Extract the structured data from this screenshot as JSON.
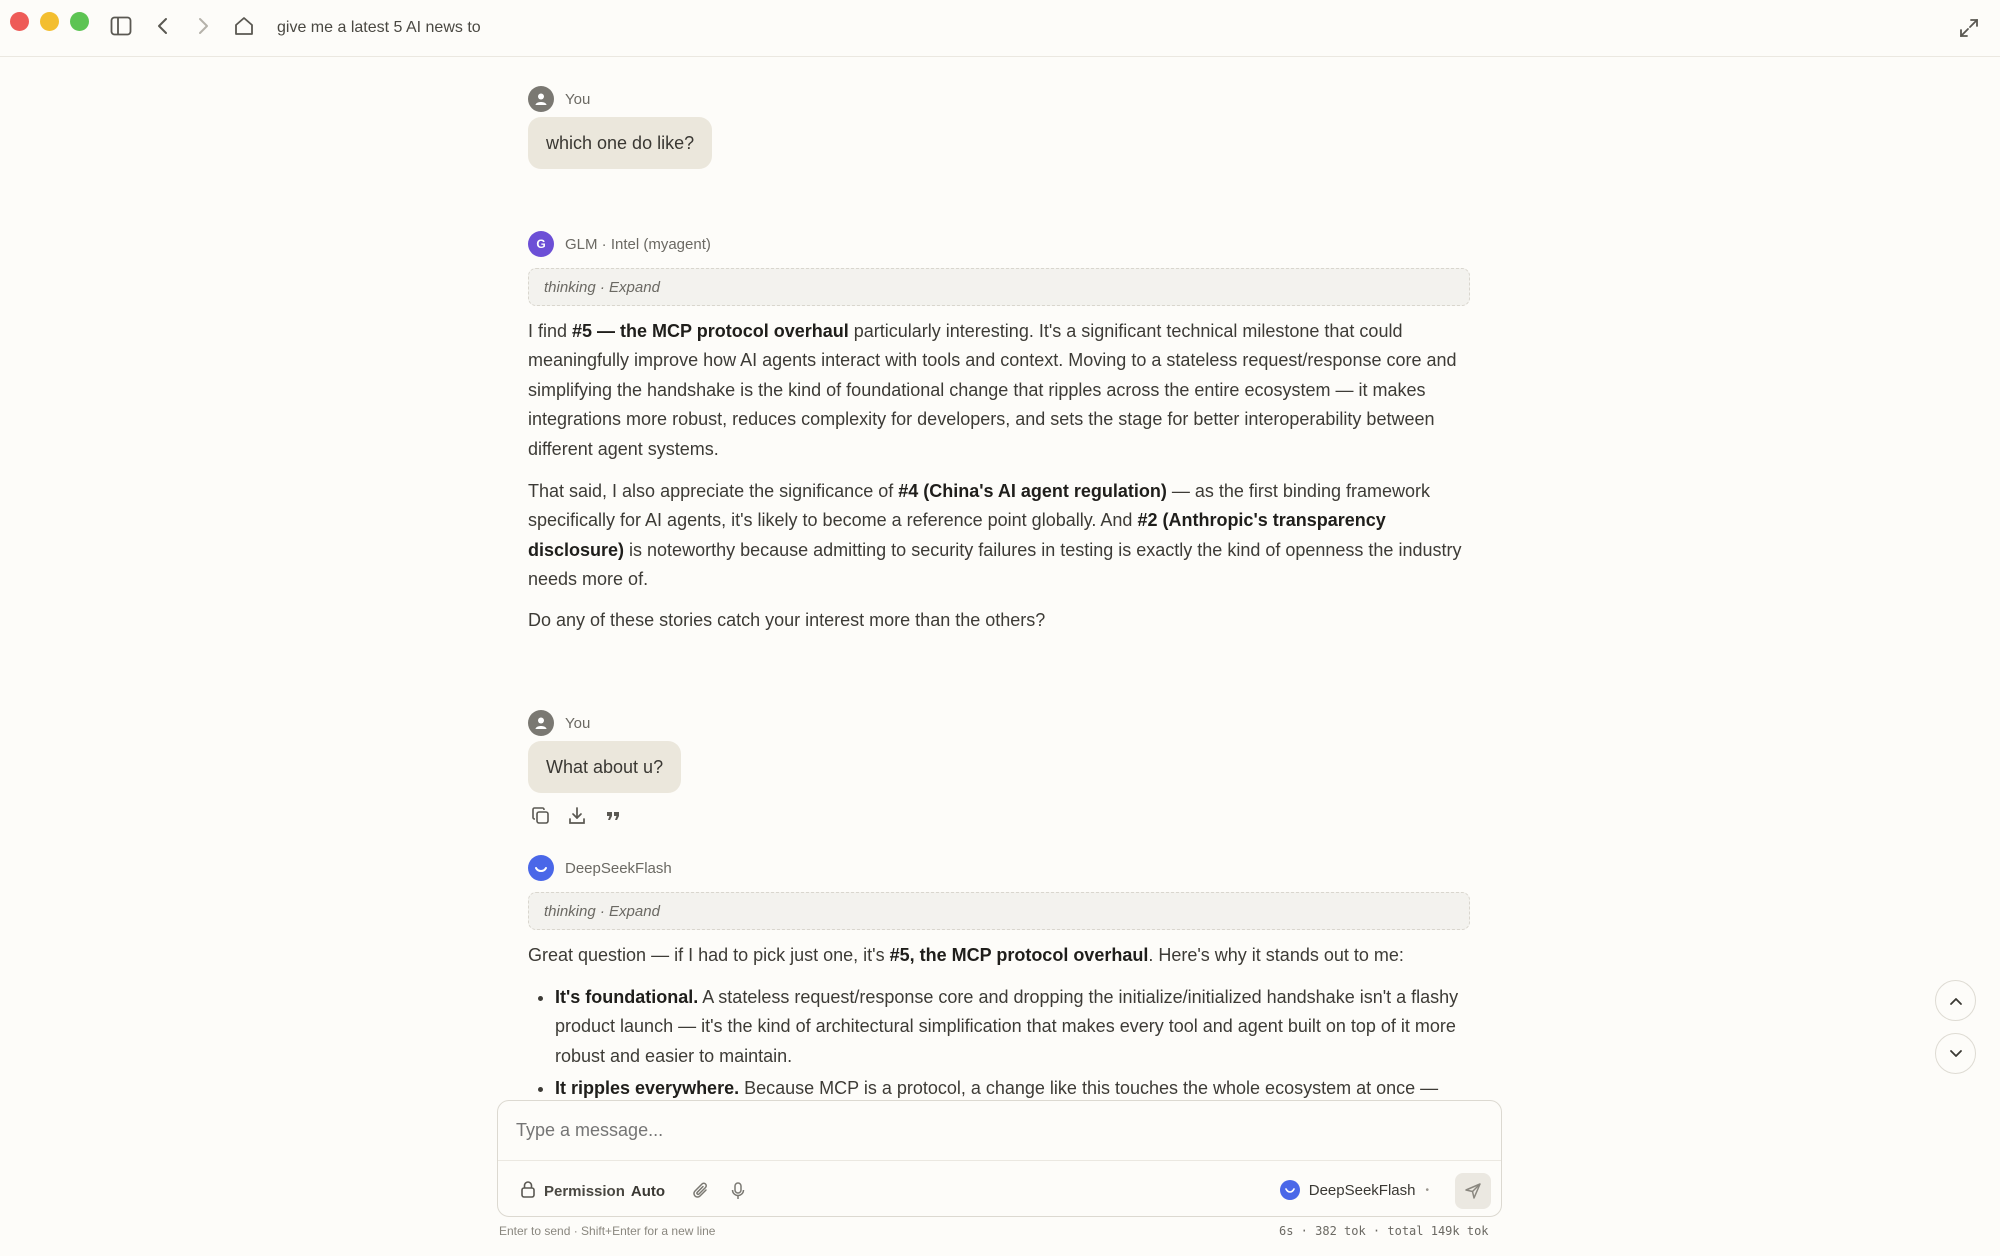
{
  "window": {
    "title": "give me a latest 5 AI news to"
  },
  "messages": [
    {
      "author": "You",
      "text": "which one do like?"
    },
    {
      "author": "GLM · Intel  (myagent)",
      "avatar_letter": "G",
      "thinking": "thinking · Expand",
      "paragraphs": [
        [
          {
            "t": "I find "
          },
          {
            "t": "#5 — the MCP protocol overhaul",
            "b": true
          },
          {
            "t": " particularly interesting. It's a significant technical milestone that could meaningfully improve how AI agents interact with tools and context. Moving to a stateless request/response core and simplifying the handshake is the kind of foundational change that ripples across the entire ecosystem — it makes integrations more robust, reduces complexity for developers, and sets the stage for better interoperability between different agent systems."
          }
        ],
        [
          {
            "t": "That said, I also appreciate the significance of "
          },
          {
            "t": "#4 (China's AI agent regulation)",
            "b": true
          },
          {
            "t": " — as the first binding framework specifically for AI agents, it's likely to become a reference point globally. And "
          },
          {
            "t": "#2 (Anthropic's transparency disclosure)",
            "b": true
          },
          {
            "t": " is noteworthy because admitting to security failures in testing is exactly the kind of openness the industry needs more of."
          }
        ],
        [
          {
            "t": "Do any of these stories catch your interest more than the others?"
          }
        ]
      ]
    },
    {
      "author": "You",
      "text": "What about u?"
    },
    {
      "author": "DeepSeekFlash",
      "thinking": "thinking · Expand",
      "intro": [
        {
          "t": "Great question — if I had to pick just one, it's "
        },
        {
          "t": "#5, the MCP protocol overhaul",
          "b": true
        },
        {
          "t": ". Here's why it stands out to me:"
        }
      ],
      "points": [
        [
          {
            "t": "It's foundational.",
            "b": true
          },
          {
            "t": " A stateless request/response core and dropping the initialize/initialized handshake isn't a flashy product launch — it's the kind of architectural simplification that makes every tool and agent built on top of it more robust and easier to maintain."
          }
        ],
        [
          {
            "t": "It ripples everywhere.",
            "b": true
          },
          {
            "t": " Because MCP is a protocol, a change like this touches the whole ecosystem at once —"
          }
        ]
      ]
    }
  ],
  "message_actions": {
    "icons": [
      "copy-icon",
      "download-icon",
      "quote-icon"
    ]
  },
  "composer": {
    "placeholder": "Type a message...",
    "permission_label": "Permission",
    "permission_value": "Auto",
    "model": "DeepSeekFlash",
    "hint": "Enter to send · Shift+Enter for a new line",
    "stats": "6s · 382 tok · total 149k tok"
  },
  "colors": {
    "background": "#fdfcf9",
    "bubble": "#ebe7dc",
    "glm_avatar": "#6c4fd6",
    "deepseek_avatar": "#4a67e8"
  }
}
